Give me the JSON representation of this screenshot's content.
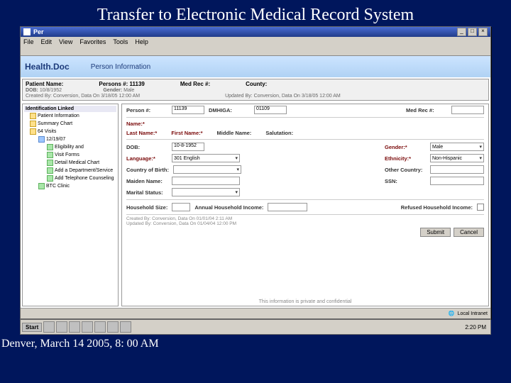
{
  "slide": {
    "title": "Transfer to Electronic Medical Record System",
    "footer": "Denver, March 14 2005, 8: 00 AM"
  },
  "window": {
    "title": "Per",
    "menu": [
      "File",
      "Edit",
      "View",
      "Favorites",
      "Tools",
      "Help"
    ],
    "brand": "Health.Doc",
    "section": "Person Information"
  },
  "info": {
    "name_l": "Patient Name:",
    "persons_l": "Persons #:",
    "persons_v": "11139",
    "med_l": "Med Rec #:",
    "county_l": "County:",
    "dob_l": "DOB:",
    "dob_v": "10/8/1952",
    "gender_l": "Gender:",
    "gender_v": "Male",
    "created": "Created By: Conversion, Data On 3/18/05 12:00 AM",
    "updated": "Updated By: Conversion, Data On 3/18/05 12:00 AM"
  },
  "tree": {
    "head": "Identification Linked",
    "n0": "Patient Information",
    "n1": "Summary Chart",
    "n2": "64 Visits",
    "n3": "12/19/07",
    "n4": "Eligibility and",
    "n5": "Visit Forms",
    "n6": "Detail Medical Chart",
    "n7": "Add a Department/Service",
    "n8": "Add Telephone Counseling",
    "n9": "BTC Clinic"
  },
  "form": {
    "person_l": "Person #:",
    "person_v": "11139",
    "dmhiga_l": "DMHIGA:",
    "dmhiga_v": "01109",
    "medrec_l": "Med Rec #:",
    "name_l": "Name:*",
    "last_l": "Last Name:*",
    "first_l": "First Name:*",
    "middle_l": "Middle Name:",
    "salut_l": "Salutation:",
    "dob_l": "DOB:",
    "dob_v": "10-8-1952",
    "gender_l": "Gender:*",
    "gender_v": "Male",
    "lang_l": "Language:*",
    "lang_v": "301 English",
    "eth_l": "Ethnicity:*",
    "eth_v": "Non-Hispanic",
    "cob_l": "Country of Birth:",
    "oc_l": "Other Country:",
    "maiden_l": "Maiden Name:",
    "ssn_l": "SSN:",
    "marital_l": "Marital Status:",
    "hh_l": "Household Size:",
    "inc_l": "Annual Household Income:",
    "ref_l": "Refused Household Income:",
    "audit1": "Created By: Conversion, Data On 01/01/04 2:11 AM",
    "audit2": "Updated By: Conversion, Data On 01/04/04 12:00 PM",
    "submit": "Submit",
    "cancel": "Cancel"
  },
  "status": {
    "msg": "This information is private and confidential",
    "local": "Local Intranet"
  },
  "taskbar": {
    "start": "Start",
    "time": "2:20 PM"
  }
}
